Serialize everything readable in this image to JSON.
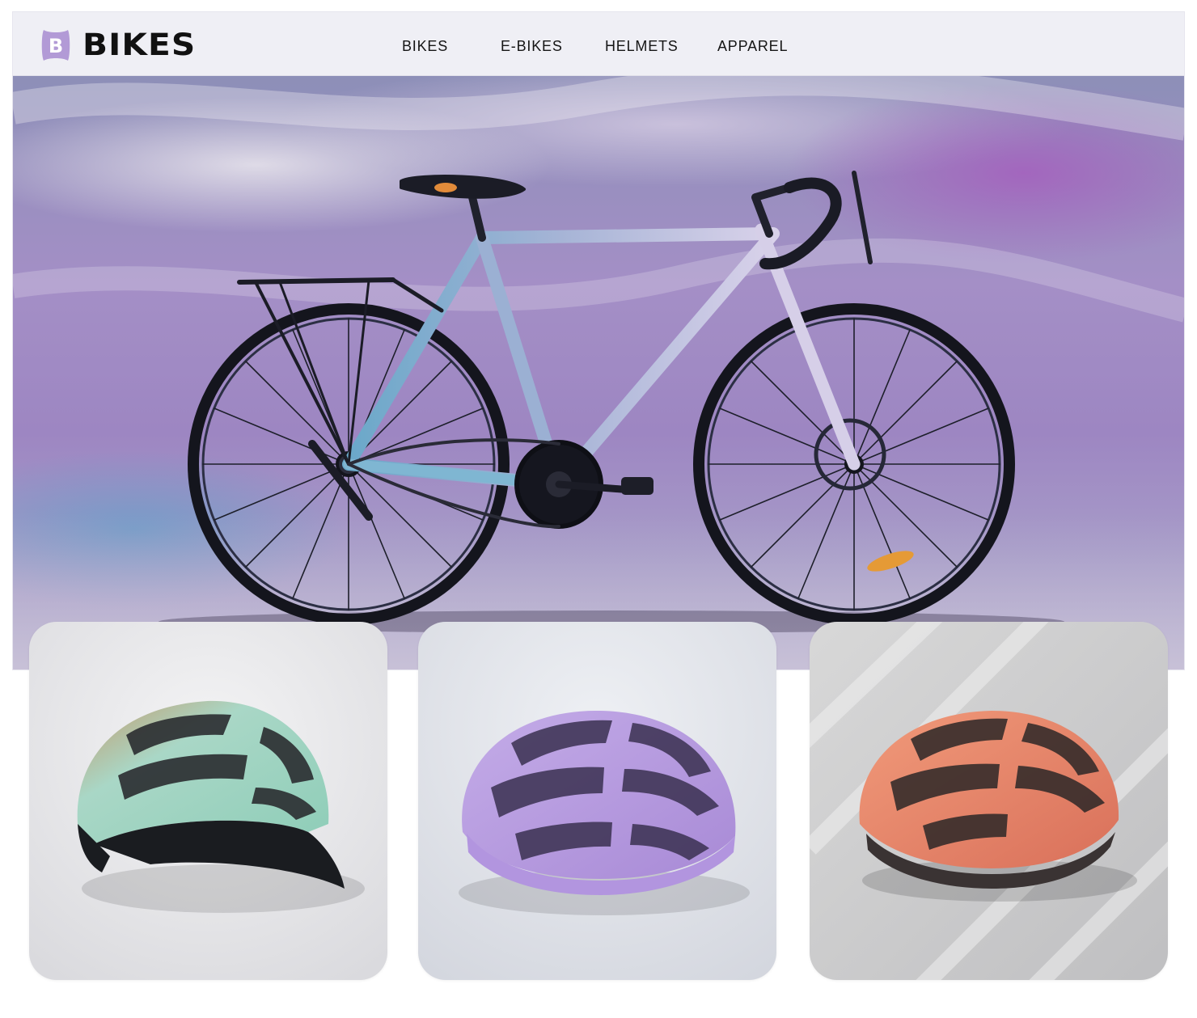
{
  "brand": {
    "logo_letter": "B",
    "name": "BIKES",
    "accent_color": "#b29ad6"
  },
  "nav": {
    "items": [
      {
        "label": "BIKES"
      },
      {
        "label": "E-BIKES"
      },
      {
        "label": "HELMETS"
      },
      {
        "label": "APPAREL"
      }
    ]
  },
  "hero": {
    "image": "road-bike-photo"
  },
  "products": [
    {
      "image": "mint-helmet-photo",
      "color": "#9fd3c1"
    },
    {
      "image": "lavender-helmet-photo",
      "color": "#b79ce0"
    },
    {
      "image": "coral-helmet-photo",
      "color": "#e9876a"
    }
  ]
}
